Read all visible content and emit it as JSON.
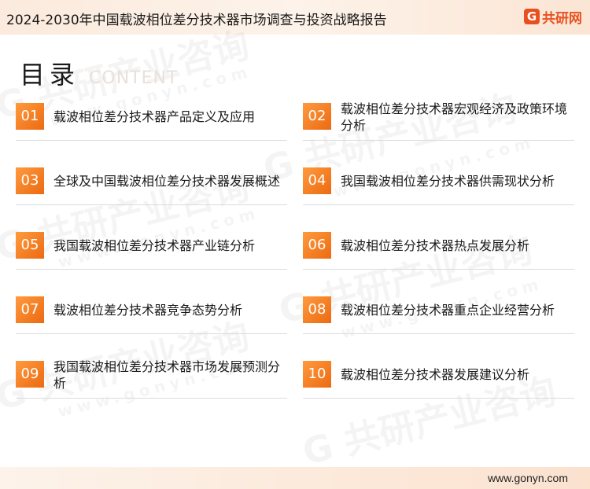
{
  "header": {
    "title": "2024-2030年中国载波相位差分技术器市场调查与投资战略报告",
    "logo_mark": "G",
    "logo_text": "共研网"
  },
  "watermark": {
    "text": "G 共研产业咨询",
    "url": "www.gonyn.com"
  },
  "heading": {
    "cn": "目录",
    "en": "CONTENT"
  },
  "toc": [
    {
      "num": "01",
      "label": "载波相位差分技术器产品定义及应用"
    },
    {
      "num": "02",
      "label": "载波相位差分技术器宏观经济及政策环境分析"
    },
    {
      "num": "03",
      "label": "全球及中国载波相位差分技术器发展概述"
    },
    {
      "num": "04",
      "label": "我国载波相位差分技术器供需现状分析"
    },
    {
      "num": "05",
      "label": "我国载波相位差分技术器产业链分析"
    },
    {
      "num": "06",
      "label": "载波相位差分技术器热点发展分析"
    },
    {
      "num": "07",
      "label": "载波相位差分技术器竞争态势分析"
    },
    {
      "num": "08",
      "label": "载波相位差分技术器重点企业经营分析"
    },
    {
      "num": "09",
      "label": "我国载波相位差分技术器市场发展预测分析"
    },
    {
      "num": "10",
      "label": "载波相位差分技术器发展建议分析"
    }
  ],
  "footer": {
    "url": "www.gonyn.com"
  },
  "colors": {
    "accent": "#ec6a12",
    "accent_light": "#ff9a3d"
  }
}
